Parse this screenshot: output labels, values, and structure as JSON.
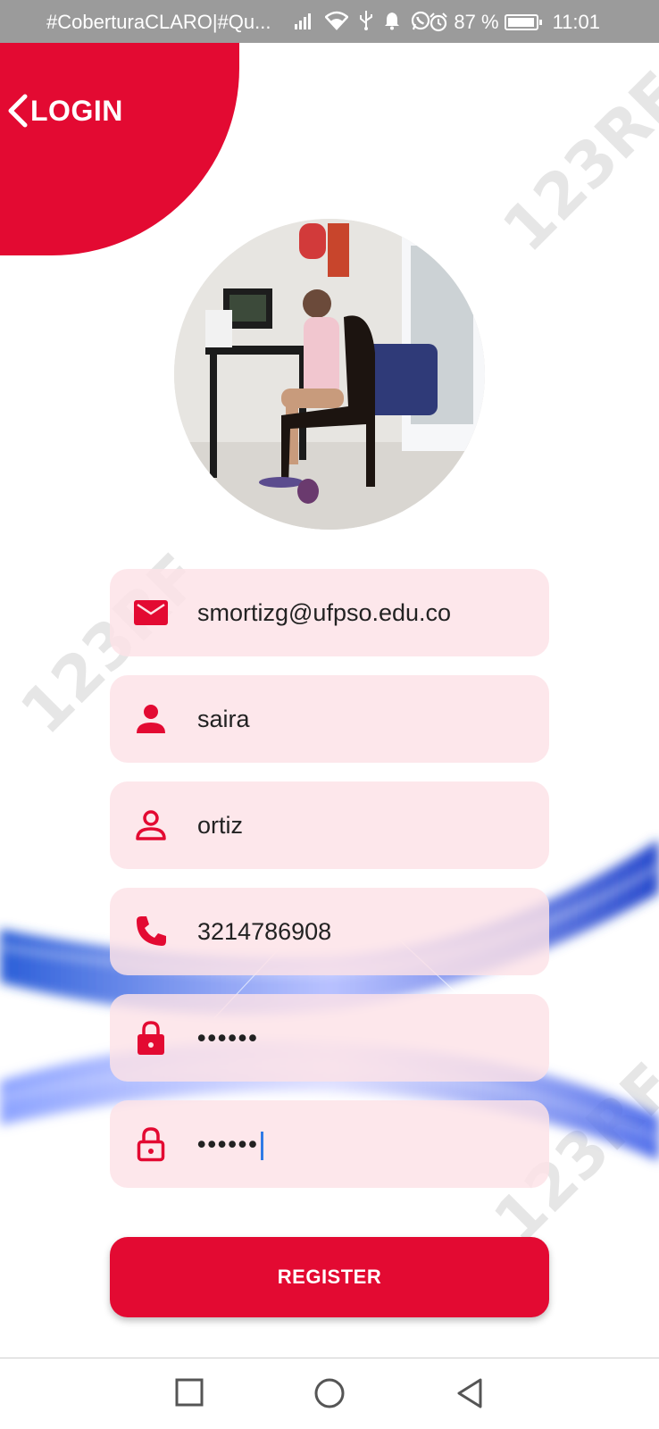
{
  "status_bar": {
    "carrier_text": "#CoberturaCLARO|#Qu...",
    "battery": "87 %",
    "battery_level": 0.87,
    "time": "11:01"
  },
  "header": {
    "back_label": "LOGIN"
  },
  "form": {
    "email": "smortizg@ufpso.edu.co",
    "first_name": "saira",
    "last_name": "ortiz",
    "phone": "3214786908",
    "password": "••••••",
    "confirm_password": "••••••"
  },
  "register_label": "REGISTER",
  "watermark_text": "123RF",
  "colors": {
    "accent": "#e30a32",
    "field_bg": "#fce2e6",
    "status_bar": "#9b9b9b"
  }
}
